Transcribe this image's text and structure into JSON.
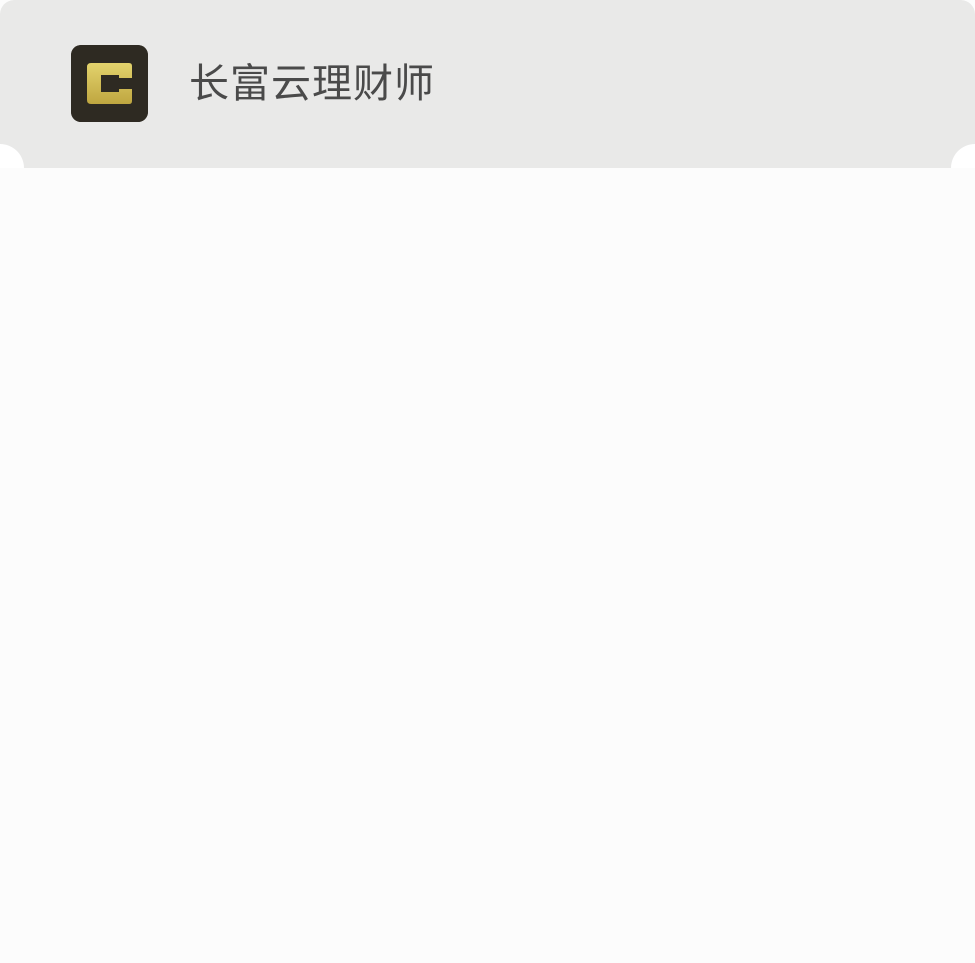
{
  "app": {
    "title": "长富云理财师",
    "icon_name": "app-logo-c-icon",
    "icon_letter": "C",
    "icon_bg_color": "#2e2a22",
    "icon_letter_color": "#d6c35a"
  },
  "colors": {
    "header_bg": "#e9e9e8",
    "body_bg": "#fcfcfc",
    "title_text": "#4a4a4a"
  }
}
